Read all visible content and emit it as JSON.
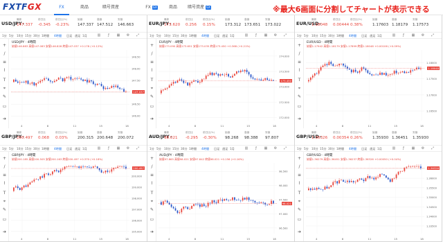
{
  "logo": {
    "part1": "FXTF",
    "part2": "GX"
  },
  "nav": [
    {
      "label": "FX",
      "active": true,
      "badge": ""
    },
    {
      "label": "商品",
      "active": false,
      "badge": ""
    },
    {
      "label": "暗号資産",
      "active": false,
      "badge": ""
    },
    {
      "label": "FX",
      "active": false,
      "badge": "GX"
    },
    {
      "label": "商品",
      "active": false,
      "badge": ""
    },
    {
      "label": "暗号資産",
      "active": false,
      "badge": "GX"
    }
  ],
  "headline": "※最大6画面に分割してチャートが表示できる",
  "quote_labels": [
    "最新",
    "前日比",
    "前日比(%)",
    "始値",
    "高値",
    "安値"
  ],
  "timeframes": [
    "1分",
    "5分",
    "10分",
    "15分",
    "30分",
    "1時間",
    "4時間",
    "日足",
    "週足",
    "1月"
  ],
  "active_timeframe": "4時間",
  "panels": [
    {
      "pair": "USD/JPY",
      "quote": [
        "147.337",
        "-0.345",
        "-0.23%",
        "147.337",
        "147.512",
        "146.663"
      ],
      "legend": "USD/JPY · 4時間",
      "ohlc": "始値146.883 高値147.083 安値146.828 終値147.037 +0.178 (+0.12%)",
      "last_tag": "147.037",
      "chart_data": {
        "type": "candlestick",
        "ylim": [
          145.8,
          148.8
        ],
        "y_ticks": [
          "148.50",
          "148.00",
          "147.50",
          "147.00",
          "146.50",
          "146.00"
        ],
        "x_ticks": [
          "4",
          "8",
          "11",
          "15",
          "18"
        ]
      },
      "seed": 11
    },
    {
      "pair": "EUR/JPY",
      "quote": [
        "173.620",
        "0.256",
        "0.15%",
        "173.312",
        "173.651",
        "173.022"
      ],
      "legend": "EUR/JPY · 4時間",
      "ohlc": "始値173.090 高値173.651 安値173.035 終値173.450 +0.368 (+0.21%)",
      "last_tag": "173.450",
      "chart_data": {
        "type": "candlestick",
        "ylim": [
          171.9,
          174.2
        ],
        "y_ticks": [
          "174.000",
          "173.500",
          "173.000",
          "172.500",
          "172.000"
        ],
        "x_ticks": [
          "4",
          "8",
          "11",
          "15",
          "18"
        ]
      },
      "seed": 23
    },
    {
      "pair": "EUR/USD",
      "quote": [
        "1.18048",
        "0.00444",
        "0.38%",
        "1.17603",
        "1.18179",
        "1.17573"
      ],
      "legend": "EUR/USD · 4時間",
      "ohlc": "始値1.17942 高値1.18179 安値1.17899 終値1.18048 +0.00106 (+0.09%)",
      "last_tag": "1.18048",
      "chart_data": {
        "type": "candlestick",
        "ylim": [
          1.162,
          1.184
        ],
        "y_ticks": [
          "1.18000",
          "1.17500",
          "1.17000",
          "1.16500"
        ],
        "x_ticks": [
          "4",
          "8",
          "11",
          "15",
          "18"
        ]
      },
      "seed": 37
    },
    {
      "pair": "GBP/JPY",
      "quote": [
        "200.497",
        "0.068",
        "0.03%",
        "200.315",
        "200.648",
        "200.072"
      ],
      "legend": "GBP/JPY · 4時間",
      "ohlc": "始値200.185 高値200.505 安値200.163 終値200.497 +0.370 (+0.18%)",
      "last_tag": "200.497",
      "chart_data": {
        "type": "candlestick",
        "ylim": [
          194.8,
          201.2
        ],
        "y_ticks": [
          "200.000",
          "199.000",
          "198.000",
          "197.000",
          "196.000",
          "195.000"
        ],
        "x_ticks": [
          "4",
          "8",
          "11",
          "15",
          "18"
        ]
      },
      "seed": 41
    },
    {
      "pair": "AUD/JPY",
      "quote": [
        "98.021",
        "-0.295",
        "-0.30%",
        "98.268",
        "98.388",
        "97.807"
      ],
      "legend": "AUD/JPY · 4時間",
      "ohlc": "始値97.865 高値98.021 安値97.842 終値98.021 +0.156 (+0.16%)",
      "last_tag": "98.021",
      "chart_data": {
        "type": "candlestick",
        "ylim": [
          96.3,
          98.8
        ],
        "y_ticks": [
          "98.500",
          "98.000",
          "97.500",
          "97.000",
          "96.500"
        ],
        "x_ticks": [
          "4",
          "8",
          "11",
          "15",
          "18"
        ]
      },
      "seed": 53
    },
    {
      "pair": "GBP/USD",
      "quote": [
        "1.36326",
        "0.00354",
        "0.26%",
        "1.35930",
        "1.36451",
        "1.35930"
      ],
      "legend": "GBP/USD · 4時間",
      "ohlc": "始値1.36279 高値1.36451 安値1.36237 終値1.36326 +0.00050 (+0.04%)",
      "last_tag": "1.36326",
      "chart_data": {
        "type": "candlestick",
        "ylim": [
          1.331,
          1.368
        ],
        "y_ticks": [
          "1.36500",
          "1.36000",
          "1.35500",
          "1.35000",
          "1.34500",
          "1.34000",
          "1.33500"
        ],
        "x_ticks": [
          "4",
          "8",
          "11",
          "15",
          "18"
        ]
      },
      "seed": 67
    }
  ],
  "colors": {
    "up": "#e8453c",
    "down": "#2a57c9",
    "accent": "#1e73e8",
    "headline": "#e8201a"
  }
}
